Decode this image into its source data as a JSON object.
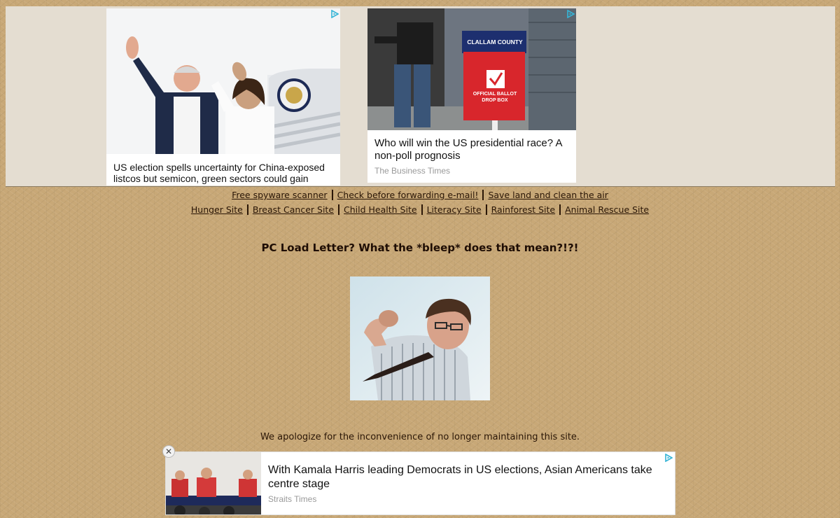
{
  "ads": {
    "top_left": {
      "caption": "US election spells uncertainty for China-exposed listcos but semicon, green sectors could gain",
      "photo_sign_text": "CLALLAM COUNTY"
    },
    "top_right": {
      "caption": "Who will win the US presidential race? A non-poll prognosis",
      "source": "The Business Times",
      "sign_county": "CLALLAM COUNTY",
      "sign_ballot": "OFFICIAL BALLOT",
      "sign_dropbox": "DROP BOX"
    },
    "bottom": {
      "caption": "With Kamala Harris leading Democrats in US elections, Asian Americans take centre stage",
      "source": "Straits Times",
      "close_label": "✕"
    }
  },
  "links_row1": [
    "Free spyware scanner",
    "Check before forwarding e-mail!",
    "Save land and clean the air"
  ],
  "links_row2": [
    "Hunger Site",
    "Breast Cancer Site",
    "Child Health Site",
    "Literacy Site",
    "Rainforest Site",
    "Animal Rescue Site"
  ],
  "page": {
    "title": "PC Load Letter? What the *bleep* does that mean?!?!",
    "apology": "We apologize for the inconvenience of no longer maintaining this site."
  },
  "colors": {
    "background": "#c8a877",
    "text": "#2a1606",
    "ad_band": "#e4ddd1",
    "ad_choice": "#35b4d6",
    "ballot_red": "#d8262c",
    "ballot_blue": "#1d2f6f"
  },
  "icons": {
    "ad_choice": "adchoices-triangle-icon",
    "close": "close-icon"
  }
}
